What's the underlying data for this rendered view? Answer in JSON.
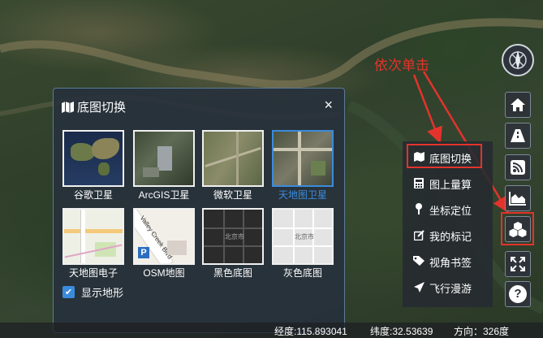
{
  "panel": {
    "title": "底图切换",
    "close_icon": "×",
    "tiles": [
      {
        "label": "谷歌卫星"
      },
      {
        "label": "ArcGIS卫星"
      },
      {
        "label": "微软卫星"
      },
      {
        "label": "天地图卫星",
        "selected": true
      },
      {
        "label": "天地图电子"
      },
      {
        "label": "OSM地图"
      },
      {
        "label": "黑色底图"
      },
      {
        "label": "灰色底图"
      }
    ],
    "osm_street": "Valley Creek Blvd",
    "osm_parking": "P",
    "dark_map_text": "北京市",
    "gray_map_text": "北京市",
    "terrain_label": "显示地形",
    "terrain_checked": true
  },
  "menu": {
    "items": [
      {
        "label": "底图切换",
        "icon": "map-icon"
      },
      {
        "label": "图上量算",
        "icon": "calculator-icon"
      },
      {
        "label": "坐标定位",
        "icon": "pin-icon"
      },
      {
        "label": "我的标记",
        "icon": "edit-icon"
      },
      {
        "label": "视角书签",
        "icon": "tag-icon"
      },
      {
        "label": "飞行漫游",
        "icon": "plane-icon"
      }
    ]
  },
  "toolbar": {
    "buttons": [
      "home-icon",
      "road-icon",
      "rss-icon",
      "area-chart-icon",
      "cubes-icon",
      "expand-icon",
      "help-icon"
    ],
    "help_label": "?"
  },
  "annotation": "依次单击",
  "status": {
    "lon": "经度:115.893041",
    "lat": "纬度:32.53639",
    "heading": "方向：326度"
  },
  "colors": {
    "highlight": "#e3332c",
    "accent": "#3b8bdc"
  }
}
